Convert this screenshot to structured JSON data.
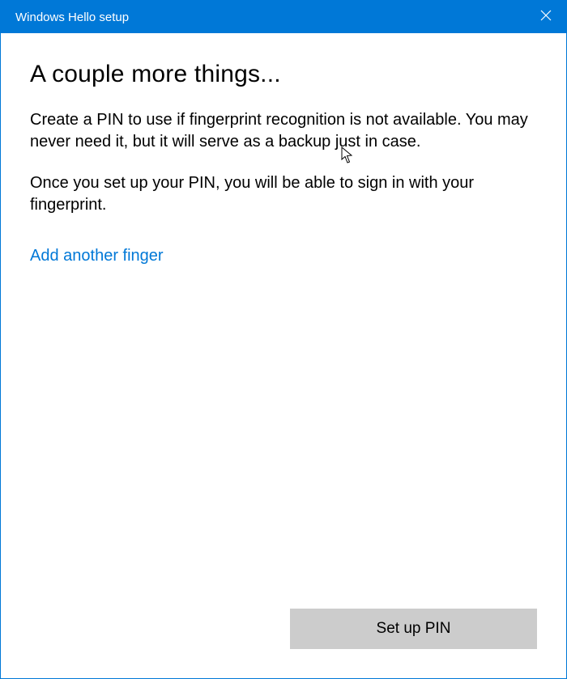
{
  "titlebar": {
    "title": "Windows Hello setup"
  },
  "content": {
    "heading": "A couple more things...",
    "paragraph1": "Create a PIN to use if fingerprint recognition is not available. You may never need it, but it will serve as a backup just in case.",
    "paragraph2": "Once you set up your PIN, you will be able to sign in with your fingerprint.",
    "link_label": "Add another finger"
  },
  "footer": {
    "primary_button_label": "Set up PIN"
  },
  "colors": {
    "accent": "#0078d7",
    "button_bg": "#cccccc"
  }
}
